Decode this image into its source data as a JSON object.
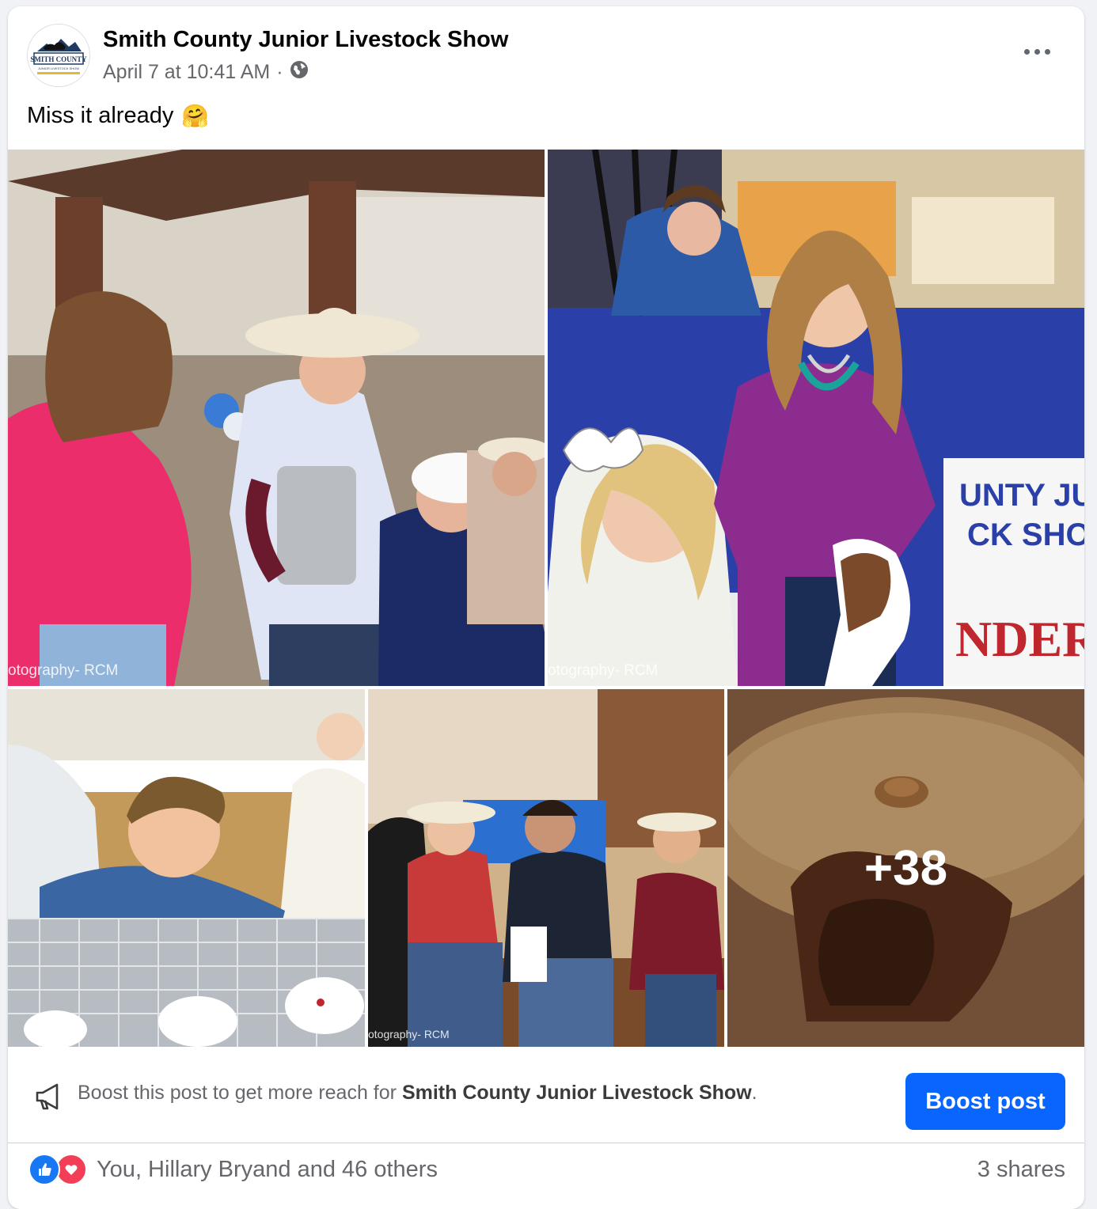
{
  "post": {
    "page_name": "Smith County Junior Livestock Show",
    "logo_text": "SMITH COUNTY",
    "logo_subtext": "JUNIOR LIVESTOCK SHOW",
    "date": "April 7 at 10:41 AM",
    "separator": "·",
    "audience_icon": "globe-icon",
    "text": "Miss it already",
    "emoji": "🤗"
  },
  "photos": {
    "watermark_1": "otography- RCM",
    "watermark_2": "otography- RCM",
    "watermark_4": "otography- RCM",
    "more_count": "+38"
  },
  "boost": {
    "prefix": "Boost this post to get more reach for ",
    "page_name": "Smith County Junior Livestock Show",
    "suffix": ".",
    "button_label": "Boost post"
  },
  "engagement": {
    "reactions_text": "You, Hillary Bryand and 46 others",
    "shares": "3 shares"
  },
  "colors": {
    "accent": "#0866ff",
    "like": "#1877f2",
    "love": "#f33e58"
  }
}
